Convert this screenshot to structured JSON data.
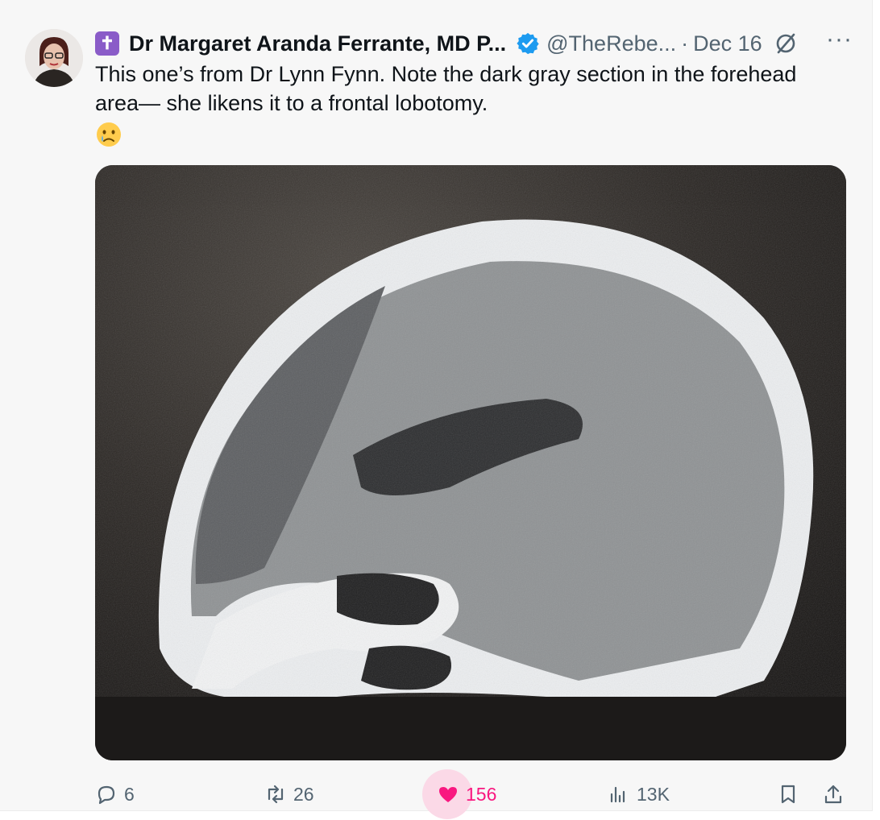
{
  "tweet": {
    "author": {
      "badge_glyph": "✝",
      "display_name": "Dr Margaret Aranda Ferrante, MD P...",
      "verified": true,
      "handle": "@TheRebe...",
      "separator": "·",
      "date": "Dec 16"
    },
    "text_line1": "This one’s from Dr Lynn Fynn. Note the dark gray section in the forehead",
    "text_line2": "area— she likens it to a frontal lobotomy.",
    "emoji": "crying-face",
    "media_alt": "CT scan of a head",
    "more_label": "···",
    "actions": {
      "replies": "6",
      "reposts": "26",
      "likes": "156",
      "views": "13K"
    },
    "colors": {
      "like_accent": "#f91880",
      "verified_blue": "#1d9bf0",
      "badge_purple": "#8a5cc8",
      "muted_text": "#536471"
    },
    "icons": [
      "reply-icon",
      "repost-icon",
      "like-icon",
      "views-icon",
      "bookmark-icon",
      "share-icon",
      "verified-icon",
      "grok-icon",
      "more-icon"
    ]
  }
}
